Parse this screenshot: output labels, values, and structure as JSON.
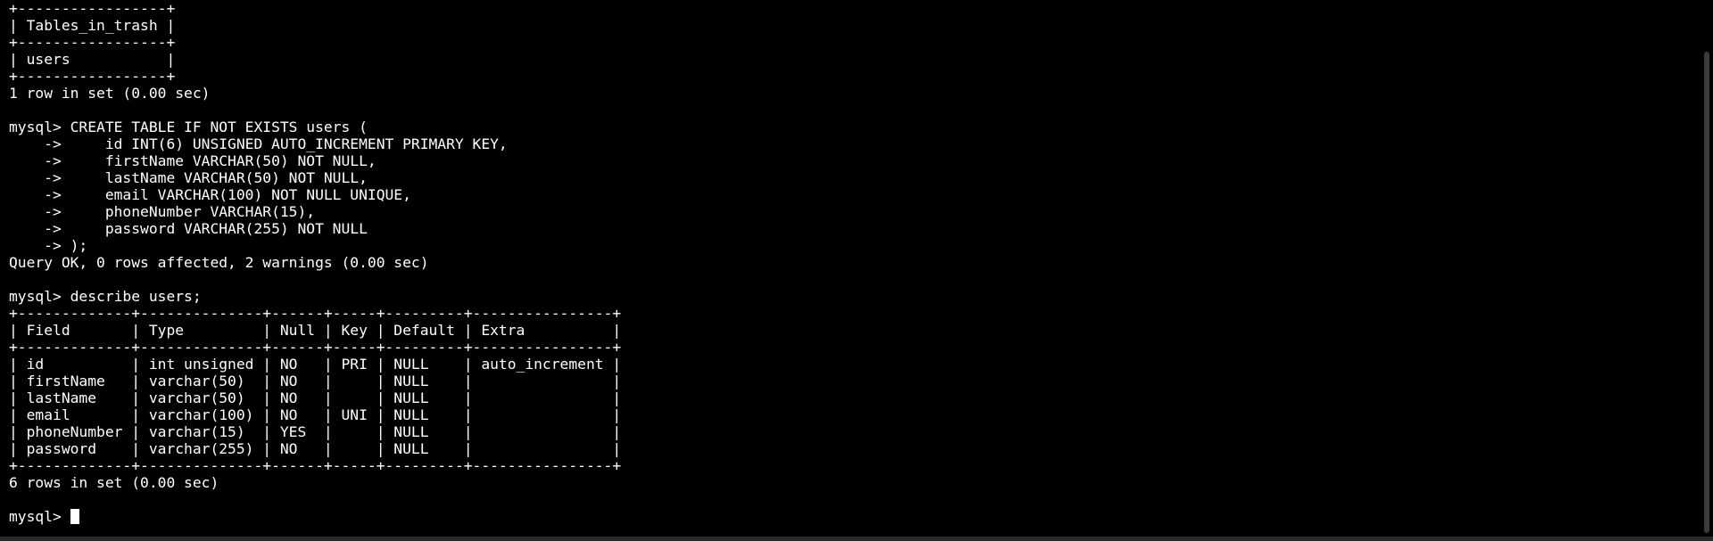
{
  "terminal": {
    "lines": [
      "+-----------------+",
      "| Tables_in_trash |",
      "+-----------------+",
      "| users           |",
      "+-----------------+",
      "1 row in set (0.00 sec)",
      "",
      "mysql> CREATE TABLE IF NOT EXISTS users (",
      "    ->     id INT(6) UNSIGNED AUTO_INCREMENT PRIMARY KEY,",
      "    ->     firstName VARCHAR(50) NOT NULL,",
      "    ->     lastName VARCHAR(50) NOT NULL,",
      "    ->     email VARCHAR(100) NOT NULL UNIQUE,",
      "    ->     phoneNumber VARCHAR(15),",
      "    ->     password VARCHAR(255) NOT NULL",
      "    -> );",
      "Query OK, 0 rows affected, 2 warnings (0.00 sec)",
      "",
      "mysql> describe users;",
      "+-------------+--------------+------+-----+---------+----------------+",
      "| Field       | Type         | Null | Key | Default | Extra          |",
      "+-------------+--------------+------+-----+---------+----------------+",
      "| id          | int unsigned | NO   | PRI | NULL    | auto_increment |",
      "| firstName   | varchar(50)  | NO   |     | NULL    |                |",
      "| lastName    | varchar(50)  | NO   |     | NULL    |                |",
      "| email       | varchar(100) | NO   | UNI | NULL    |                |",
      "| phoneNumber | varchar(15)  | YES  |     | NULL    |                |",
      "| password    | varchar(255) | NO   |     | NULL    |                |",
      "+-------------+--------------+------+-----+---------+----------------+",
      "6 rows in set (0.00 sec)",
      ""
    ],
    "prompt": "mysql> ",
    "input_value": "",
    "colors": {
      "background": "#000000",
      "foreground": "#ffffff",
      "cursor": "#ffffff"
    }
  }
}
